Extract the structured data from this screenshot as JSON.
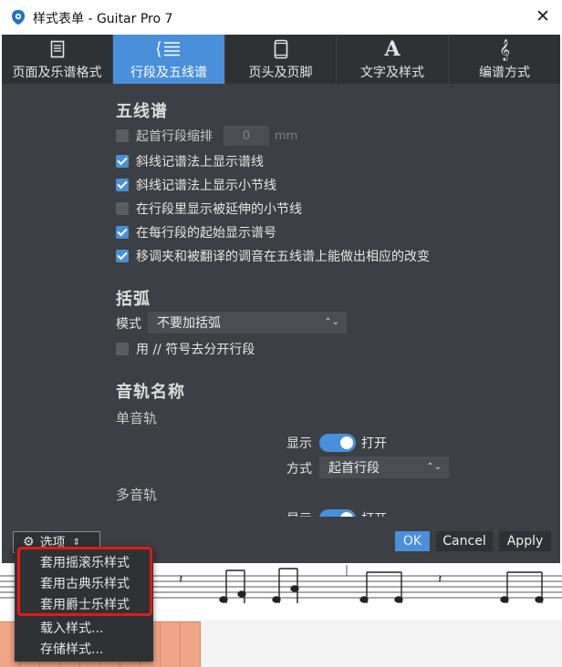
{
  "window": {
    "title": "样式表单 - Guitar Pro 7",
    "close_glyph": "✕",
    "icon": "guitar-pro-logo-icon"
  },
  "tabs": [
    {
      "label": "页面及乐谱格式",
      "icon": "page-icon",
      "active": false
    },
    {
      "label": "行段及五线谱",
      "icon": "staff-lines-icon",
      "active": true
    },
    {
      "label": "页头及页脚",
      "icon": "phone-page-icon",
      "active": false
    },
    {
      "label": "文字及样式",
      "icon": "text-A-icon",
      "active": false
    },
    {
      "label": "编谱方式",
      "icon": "treble-clef-icon",
      "active": false
    }
  ],
  "staff_section": {
    "title": "五线谱",
    "options": [
      {
        "label": "起首行段缩排",
        "checked": false,
        "value": "0",
        "unit": "mm"
      },
      {
        "label": "斜线记谱法上显示谱线",
        "checked": true
      },
      {
        "label": "斜线记谱法上显示小节线",
        "checked": true
      },
      {
        "label": "在行段里显示被延伸的小节线",
        "checked": false
      },
      {
        "label": "在每行段的起始显示谱号",
        "checked": true
      },
      {
        "label": "移调夹和被翻译的调音在五线谱上能做出相应的改变",
        "checked": true
      }
    ]
  },
  "bracket_section": {
    "title": "括弧",
    "mode_label": "模式",
    "mode_value": "不要加括弧",
    "split_option": {
      "label": "用 // 符号去分开行段",
      "checked": false
    }
  },
  "track_name_section": {
    "title": "音轨名称",
    "single_track": {
      "label": "单音轨",
      "show_label": "显示",
      "show_state": "打开",
      "show_on": true,
      "method_label": "方式",
      "method_value": "起首行段"
    },
    "multi_track": {
      "label": "多音轨",
      "show_label": "显示",
      "show_state": "打开",
      "show_on": true
    }
  },
  "footer": {
    "options_label": "选项",
    "options_icon": "gear-icon",
    "ok_label": "OK",
    "cancel_label": "Cancel",
    "apply_label": "Apply"
  },
  "options_menu": {
    "items": [
      "套用摇滚乐样式",
      "套用古典乐样式",
      "套用爵士乐样式",
      "载入样式...",
      "存储样式..."
    ]
  },
  "colors": {
    "accent": "#4a8fd9",
    "dialog_bg": "#3c3f43",
    "tabbar_bg": "#2f3235",
    "highlight_red": "#e01b12",
    "cell_salmon": "#f0a488"
  }
}
